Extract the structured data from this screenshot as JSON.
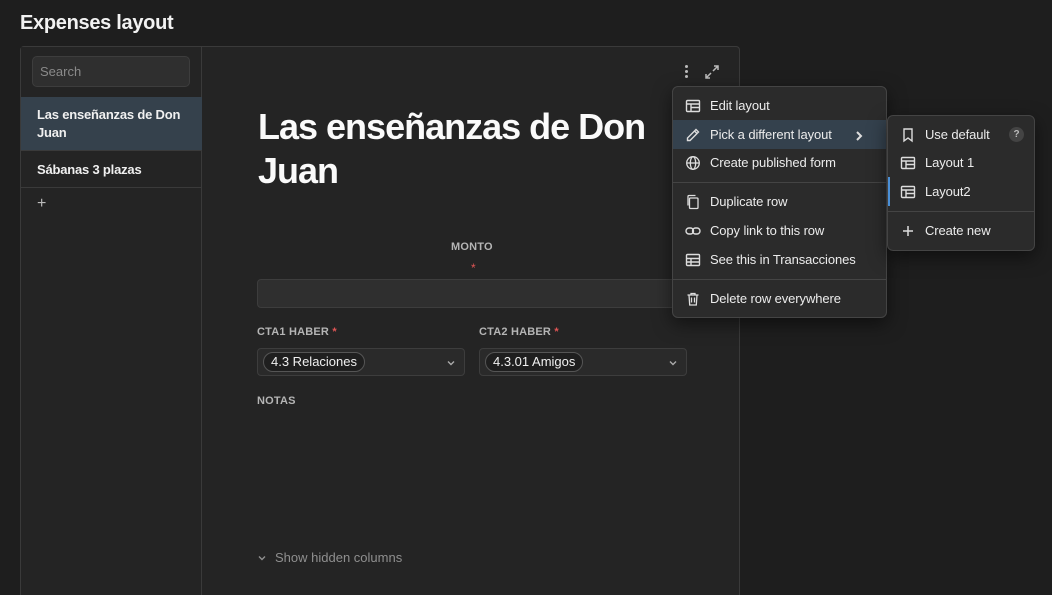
{
  "page": {
    "title": "Expenses layout"
  },
  "sidebar": {
    "search_placeholder": "Search",
    "records": [
      {
        "label": "Las enseñanzas de Don Juan",
        "selected": true
      },
      {
        "label": "Sábanas 3 plazas",
        "selected": false
      }
    ],
    "add_label": "+"
  },
  "record": {
    "title": "Las enseñanzas de Don Juan",
    "fields": {
      "monto": {
        "label": "MONTO",
        "required_mark": "*",
        "value": ""
      },
      "cta1": {
        "label": "CTA1 HABER",
        "required_mark": "*",
        "value": "4.3 Relaciones"
      },
      "cta2": {
        "label": "CTA2 HABER",
        "required_mark": "*",
        "value": "4.3.01 Amigos"
      },
      "notas": {
        "label": "NOTAS",
        "value": ""
      }
    },
    "show_hidden_label": "Show hidden columns"
  },
  "row_menu": {
    "items": [
      {
        "label": "Edit layout",
        "icon": "layout-icon"
      },
      {
        "label": "Pick a different layout",
        "icon": "pencil-icon",
        "highlighted": true,
        "submenu": true
      },
      {
        "label": "Create published form",
        "icon": "globe-icon"
      },
      {
        "label": "Duplicate row",
        "icon": "copy-icon"
      },
      {
        "label": "Copy link to this row",
        "icon": "link-icon"
      },
      {
        "label": "See this in Transacciones",
        "icon": "table-icon"
      },
      {
        "label": "Delete row everywhere",
        "icon": "trash-icon"
      }
    ]
  },
  "layout_submenu": {
    "items": [
      {
        "label": "Use default",
        "icon": "bookmark-icon",
        "help": "?"
      },
      {
        "label": "Layout 1",
        "icon": "layout-icon"
      },
      {
        "label": "Layout2",
        "icon": "layout-icon",
        "active": true
      },
      {
        "label": "Create new",
        "icon": "plus-icon"
      }
    ]
  },
  "colors": {
    "background": "#1e1e1e",
    "selected_row": "#35414c",
    "menu_highlight": "#34414d",
    "required": "#e05555",
    "active_indicator": "#4a8fd6"
  }
}
